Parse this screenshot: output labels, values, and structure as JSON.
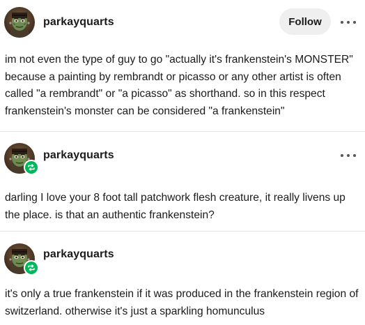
{
  "posts": [
    {
      "username": "parkayquarts",
      "follow_label": "Follow",
      "text": "im not even the type of guy to go \"actually it's frankenstein's MONSTER\" because a painting by rembrandt or picasso or any other artist is often called \"a rembrandt\" or \"a picasso\" as shorthand. so in this respect frankenstein's monster can be considered \"a frankenstein\""
    },
    {
      "username": "parkayquarts",
      "reblog": true,
      "text": "darling I love your 8 foot tall patchwork flesh creature, it really livens up the place. is that an authentic frankenstein?"
    },
    {
      "username": "parkayquarts",
      "reblog": true,
      "text": "it's only a true frankenstein if it was produced in the frankenstein region of switzerland. otherwise it's just a sparkling homunculus"
    }
  ],
  "colors": {
    "reblog_badge": "#00b85c",
    "follow_button_bg": "#efefef",
    "divider": "#e2e2e2"
  },
  "icons": {
    "avatar": "frankenstein-monster-avatar",
    "reblog": "reblog-icon",
    "more": "more-options-icon"
  }
}
